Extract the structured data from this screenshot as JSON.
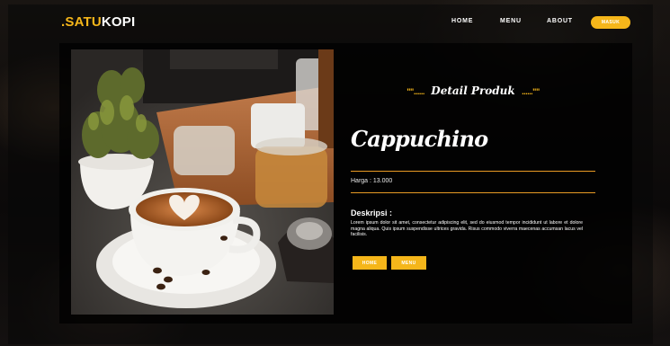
{
  "brand": {
    "prefix": ".SATU",
    "suffix": "KOPI"
  },
  "nav": {
    "items": [
      {
        "label": "HOME"
      },
      {
        "label": "MENU"
      },
      {
        "label": "ABOUT"
      }
    ],
    "login_label": "MASUK"
  },
  "detail": {
    "heading_dots_left": "\"\"......",
    "heading": "Detail Produk",
    "heading_dots_right": "......\"\""
  },
  "product": {
    "name": "Cappuchino",
    "price_label": "Harga : 13.000",
    "description_title": "Deskripsi :",
    "description": "Lorem ipsum dolor sit amet, consectetur adipiscing elit, sed do eiusmod tempor incididunt ut labore et dolore magna aliqua. Quis ipsum suspendisse ultrices gravida. Risus commodo viverra maecenas accumsan lacus vel facilisis."
  },
  "actions": {
    "home_label": "HOME",
    "menu_label": "MENU"
  },
  "colors": {
    "accent": "#f5b61a",
    "divider": "#e99b24",
    "background": "#0d0b0a"
  },
  "photo": {
    "subject": "coffee-cup-photo"
  }
}
